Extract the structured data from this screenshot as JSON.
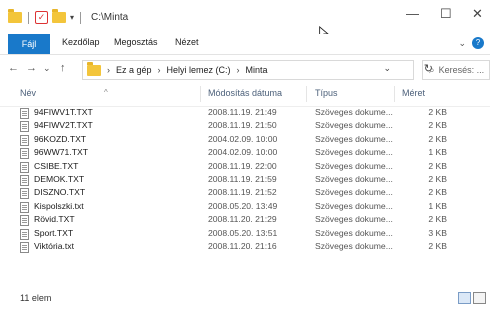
{
  "window": {
    "path_title": "C:\\Minta",
    "minimize_glyph": "—",
    "maximize_glyph": "☐",
    "close_glyph": "✕"
  },
  "ribbon": {
    "tabs": [
      "Fájl",
      "Kezdőlap",
      "Megosztás",
      "Nézet"
    ],
    "collapse_glyph": "⌄",
    "help_glyph": "?"
  },
  "nav": {
    "back": "←",
    "forward": "→",
    "history": "⌄",
    "up": "↑"
  },
  "address": {
    "leading": "›",
    "crumbs": [
      "Ez a gép",
      "Helyi lemez (C:)",
      "Minta"
    ],
    "separator": "›",
    "dropdown": "⌄",
    "refresh": "↻"
  },
  "search": {
    "icon": "⌕",
    "placeholder": "Keresés: ..."
  },
  "columns": {
    "name": "Név",
    "date": "Módosítás dátuma",
    "type": "Típus",
    "size": "Méret",
    "sort_caret": "^"
  },
  "files": [
    {
      "name": "94FIWV1T.TXT",
      "date": "2008.11.19. 21:49",
      "type": "Szöveges dokume...",
      "size": "2 KB"
    },
    {
      "name": "94FIWV2T.TXT",
      "date": "2008.11.19. 21:50",
      "type": "Szöveges dokume...",
      "size": "2 KB"
    },
    {
      "name": "96KOZD.TXT",
      "date": "2004.02.09. 10:00",
      "type": "Szöveges dokume...",
      "size": "2 KB"
    },
    {
      "name": "96WW71.TXT",
      "date": "2004.02.09. 10:00",
      "type": "Szöveges dokume...",
      "size": "1 KB"
    },
    {
      "name": "CSIBE.TXT",
      "date": "2008.11.19. 22:00",
      "type": "Szöveges dokume...",
      "size": "2 KB"
    },
    {
      "name": "DEMOK.TXT",
      "date": "2008.11.19. 21:59",
      "type": "Szöveges dokume...",
      "size": "2 KB"
    },
    {
      "name": "DISZNO.TXT",
      "date": "2008.11.19. 21:52",
      "type": "Szöveges dokume...",
      "size": "2 KB"
    },
    {
      "name": "Kispolszki.txt",
      "date": "2008.05.20. 13:49",
      "type": "Szöveges dokume...",
      "size": "1 KB"
    },
    {
      "name": "Rövid.TXT",
      "date": "2008.11.20. 21:29",
      "type": "Szöveges dokume...",
      "size": "2 KB"
    },
    {
      "name": "Sport.TXT",
      "date": "2008.05.20. 13:51",
      "type": "Szöveges dokume...",
      "size": "3 KB"
    },
    {
      "name": "Viktória.txt",
      "date": "2008.11.20. 21:16",
      "type": "Szöveges dokume...",
      "size": "2 KB"
    }
  ],
  "status": {
    "item_count": "11 elem"
  },
  "colors": {
    "accent": "#1979ca",
    "folder": "#f3c53b"
  }
}
